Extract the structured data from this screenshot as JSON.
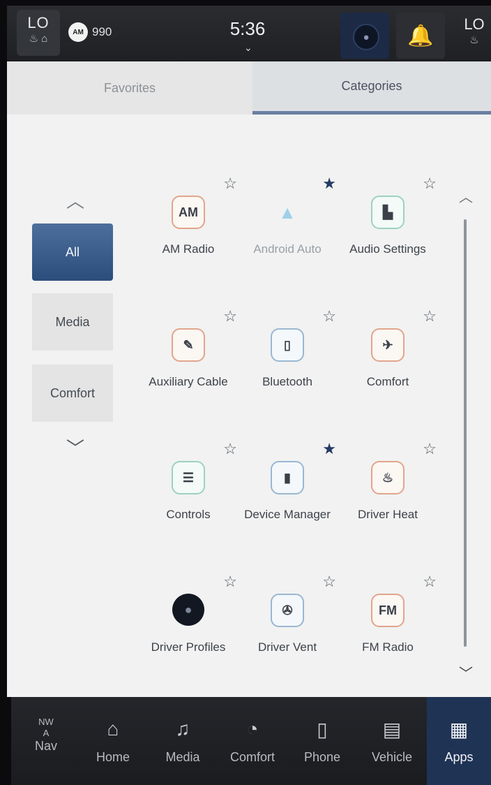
{
  "status": {
    "left_climate": "LO",
    "right_climate": "LO",
    "radio_band": "AM",
    "radio_freq": "990",
    "time": "5:36"
  },
  "tabs": [
    {
      "label": "Favorites",
      "active": false
    },
    {
      "label": "Categories",
      "active": true
    }
  ],
  "categories": [
    {
      "label": "All",
      "active": true
    },
    {
      "label": "Media",
      "active": false
    },
    {
      "label": "Comfort",
      "active": false
    }
  ],
  "apps": [
    {
      "label": "AM Radio",
      "icon_text": "AM",
      "icon": "am-radio-icon",
      "favorite": false,
      "enabled": true
    },
    {
      "label": "Android Auto",
      "icon_text": "",
      "icon": "android-auto-icon",
      "favorite": true,
      "enabled": false
    },
    {
      "label": "Audio Settings",
      "icon_text": "",
      "icon": "audio-settings-icon",
      "favorite": false,
      "enabled": true
    },
    {
      "label": "Auxiliary Cable",
      "icon_text": "",
      "icon": "aux-cable-icon",
      "favorite": false,
      "enabled": true
    },
    {
      "label": "Bluetooth",
      "icon_text": "",
      "icon": "bluetooth-icon",
      "favorite": false,
      "enabled": true
    },
    {
      "label": "Comfort",
      "icon_text": "",
      "icon": "comfort-icon",
      "favorite": false,
      "enabled": true
    },
    {
      "label": "Controls",
      "icon_text": "",
      "icon": "controls-icon",
      "favorite": false,
      "enabled": true
    },
    {
      "label": "Device Manager",
      "icon_text": "",
      "icon": "device-manager-icon",
      "favorite": true,
      "enabled": true
    },
    {
      "label": "Driver Heat",
      "icon_text": "",
      "icon": "driver-heat-icon",
      "favorite": false,
      "enabled": true
    },
    {
      "label": "Driver Profiles",
      "icon_text": "",
      "icon": "driver-profiles-icon",
      "favorite": false,
      "enabled": true
    },
    {
      "label": "Driver Vent",
      "icon_text": "",
      "icon": "driver-vent-icon",
      "favorite": false,
      "enabled": true
    },
    {
      "label": "FM Radio",
      "icon_text": "FM",
      "icon": "fm-radio-icon",
      "favorite": false,
      "enabled": true
    }
  ],
  "nav": {
    "compass": "NW",
    "compass_sub": "A",
    "items": [
      "Nav",
      "Home",
      "Media",
      "Comfort",
      "Phone",
      "Vehicle",
      "Apps"
    ],
    "active": "Apps"
  },
  "colors": {
    "accent": "#2a4d7c",
    "active_nav": "#1f3355",
    "background": "#f1f2f1"
  }
}
